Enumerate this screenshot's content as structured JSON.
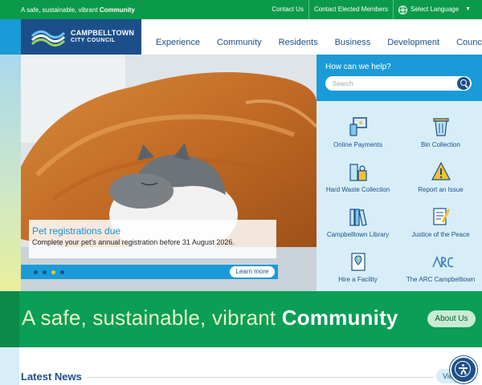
{
  "topbar": {
    "tagline_prefix": "A safe, sustainable, vibrant ",
    "tagline_bold": "Community",
    "links": [
      "Contact Us",
      "Contact Elected Members"
    ],
    "language_label": "Select Language"
  },
  "logo": {
    "line1": "CAMPBELLTOWN",
    "line2": "CITY COUNCIL"
  },
  "nav": [
    "Experience",
    "Community",
    "Residents",
    "Business",
    "Development",
    "Council"
  ],
  "hero": {
    "title": "Pet registrations due",
    "subtitle": "Complete your pet's annual registration before 31 August 2026.",
    "button": "Learn more",
    "slide_count": 4,
    "active_slide": 3
  },
  "help": {
    "title": "How can we help?",
    "search_placeholder": "Search",
    "tiles": [
      {
        "label": "Online Payments",
        "icon": "payment-icon"
      },
      {
        "label": "Bin Collection",
        "icon": "bin-icon"
      },
      {
        "label": "Hard Waste Collection",
        "icon": "hard-waste-icon"
      },
      {
        "label": "Report an Issue",
        "icon": "warning-icon"
      },
      {
        "label": "Campbelltown Library",
        "icon": "library-icon"
      },
      {
        "label": "Justice of the Peace",
        "icon": "justice-icon"
      },
      {
        "label": "Hire a Facility",
        "icon": "facility-icon"
      },
      {
        "label": "The ARC Campbelltown",
        "icon": "arc-logo"
      }
    ]
  },
  "banner": {
    "text_prefix": "A safe, sustainable, vibrant ",
    "text_bold": "Community",
    "button": "About Us"
  },
  "news": {
    "title": "Latest News",
    "button": "View"
  },
  "colors": {
    "green": "#0b9a4a",
    "blue": "#1a9bd7",
    "navy": "#1c4f8a",
    "light_blue": "#d7eef8"
  }
}
